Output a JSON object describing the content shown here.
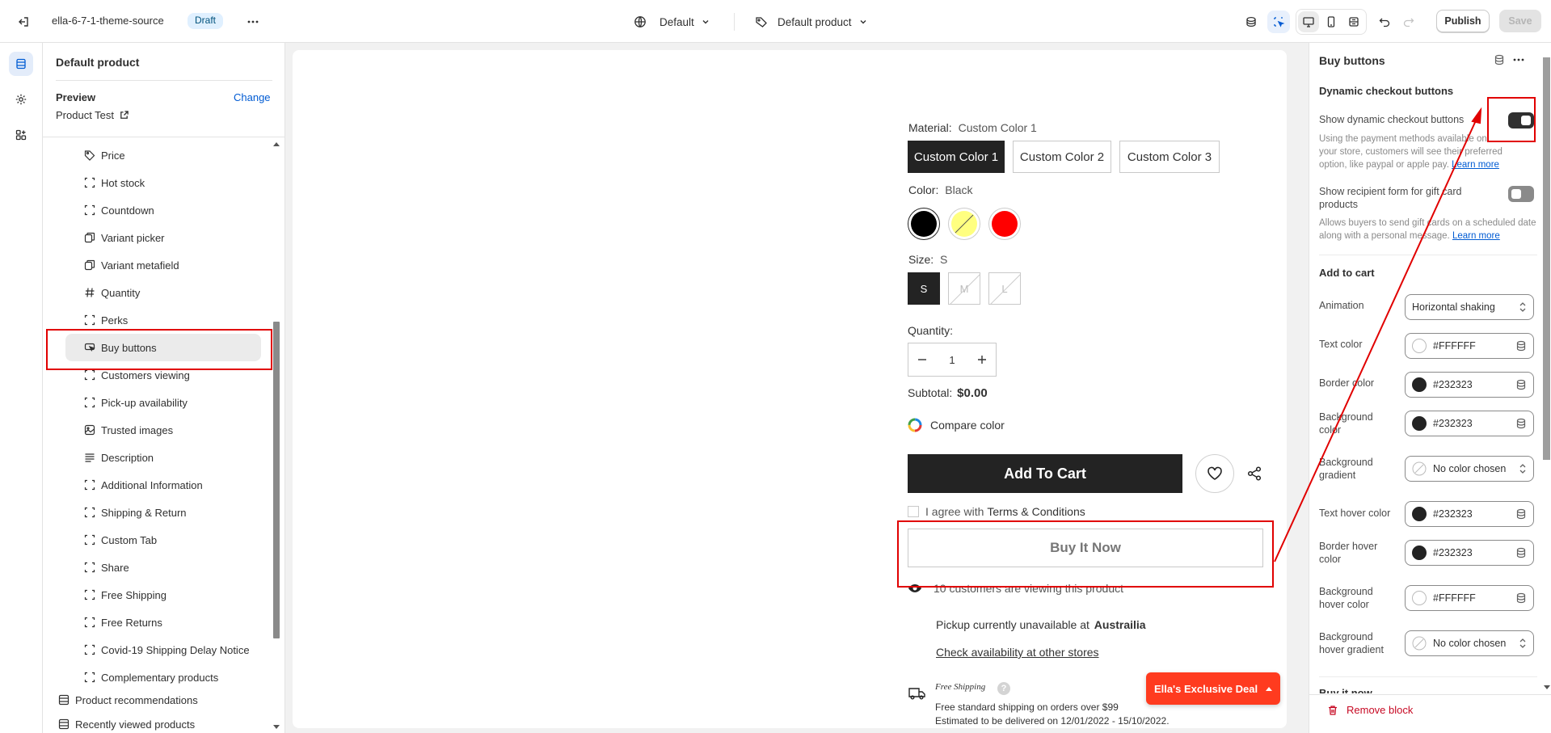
{
  "topbar": {
    "theme_name": "ella-6-7-1-theme-source",
    "status_badge": "Draft",
    "context_select": "Default",
    "template_select": "Default product",
    "publish_label": "Publish",
    "save_label": "Save"
  },
  "left_panel": {
    "title": "Default product",
    "preview_label": "Preview",
    "change_link": "Change",
    "preview_product": "Product Test",
    "items": [
      {
        "label": "Price",
        "icon": "price-tag-icon"
      },
      {
        "label": "Hot stock",
        "icon": "block-dashed-icon"
      },
      {
        "label": "Countdown",
        "icon": "block-dashed-icon"
      },
      {
        "label": "Variant picker",
        "icon": "variant-icon"
      },
      {
        "label": "Variant metafield",
        "icon": "variant-icon"
      },
      {
        "label": "Quantity",
        "icon": "hash-icon"
      },
      {
        "label": "Perks",
        "icon": "block-dashed-icon"
      },
      {
        "label": "Buy buttons",
        "icon": "cursor-button-icon"
      },
      {
        "label": "Customers viewing",
        "icon": "block-dashed-icon"
      },
      {
        "label": "Pick-up availability",
        "icon": "block-dashed-icon"
      },
      {
        "label": "Trusted images",
        "icon": "image-icon"
      },
      {
        "label": "Description",
        "icon": "text-lines-icon"
      },
      {
        "label": "Additional Information",
        "icon": "block-dashed-icon"
      },
      {
        "label": "Shipping & Return",
        "icon": "block-dashed-icon"
      },
      {
        "label": "Custom Tab",
        "icon": "block-dashed-icon"
      },
      {
        "label": "Share",
        "icon": "block-dashed-icon"
      },
      {
        "label": "Free Shipping",
        "icon": "block-dashed-icon"
      },
      {
        "label": "Free Returns",
        "icon": "block-dashed-icon"
      },
      {
        "label": "Covid-19 Shipping Delay Notice",
        "icon": "block-dashed-icon"
      },
      {
        "label": "Complementary products",
        "icon": "block-dashed-icon"
      }
    ],
    "sections": [
      {
        "label": "Product recommendations",
        "icon": "section-icon"
      },
      {
        "label": "Recently viewed products",
        "icon": "section-icon"
      }
    ]
  },
  "preview": {
    "material_label": "Material:",
    "material_value": "Custom Color 1",
    "material_options": [
      "Custom Color 1",
      "Custom Color 2",
      "Custom Color 3"
    ],
    "color_label": "Color:",
    "color_value": "Black",
    "color_swatches": [
      "#000000",
      "#ffff80",
      "#ff0000"
    ],
    "size_label": "Size:",
    "size_value": "S",
    "size_options": [
      "S",
      "M",
      "L"
    ],
    "quantity_label": "Quantity:",
    "quantity_value": "1",
    "subtotal_label": "Subtotal:",
    "subtotal_value": "$0.00",
    "compare_color": "Compare color",
    "add_to_cart": "Add To Cart",
    "agree_prefix": "I agree with",
    "agree_link": "Terms & Conditions",
    "buy_now": "Buy It Now",
    "viewing_text": "10 customers are viewing this product",
    "pickup_prefix": "Pickup currently unavailable at",
    "pickup_store": "Austrailia",
    "check_availability": "Check availability at other stores",
    "free_shipping_title": "Free Shipping",
    "free_shipping_line1": "Free standard shipping on orders over $99",
    "free_shipping_line2": "Estimated to be delivered on 12/01/2022 - 15/10/2022.",
    "exclusive_deal": "Ella's Exclusive Deal"
  },
  "right_panel": {
    "title": "Buy buttons",
    "dynamic_heading": "Dynamic checkout buttons",
    "show_dynamic_label": "Show dynamic checkout buttons",
    "show_dynamic_on": true,
    "dynamic_help": "Using the payment methods available on your store, customers will see their preferred option, like paypal or apple pay.",
    "learn_more": "Learn more",
    "recipient_label": "Show recipient form for gift card products",
    "recipient_on": false,
    "recipient_help": "Allows buyers to send gift cards on a scheduled date along with a personal message.",
    "add_to_cart_heading": "Add to cart",
    "animation_label": "Animation",
    "animation_value": "Horizontal shaking",
    "text_color_label": "Text color",
    "text_color": "#FFFFFF",
    "border_color_label": "Border color",
    "border_color": "#232323",
    "bg_color_label": "Background color",
    "bg_color": "#232323",
    "bg_gradient_label": "Background gradient",
    "bg_gradient": "No color chosen",
    "text_hover_label": "Text hover color",
    "text_hover": "#232323",
    "border_hover_label": "Border hover color",
    "border_hover": "#232323",
    "bg_hover_label": "Background hover color",
    "bg_hover": "#FFFFFF",
    "bg_hover_gradient_label": "Background hover gradient",
    "bg_hover_gradient": "No color chosen",
    "buy_it_now_heading": "Buy it now",
    "remove_block": "Remove block"
  },
  "colors": {
    "highlight_red": "#e10000",
    "accent_blue": "#005bd3",
    "deal_orange": "#ff3b1f"
  }
}
